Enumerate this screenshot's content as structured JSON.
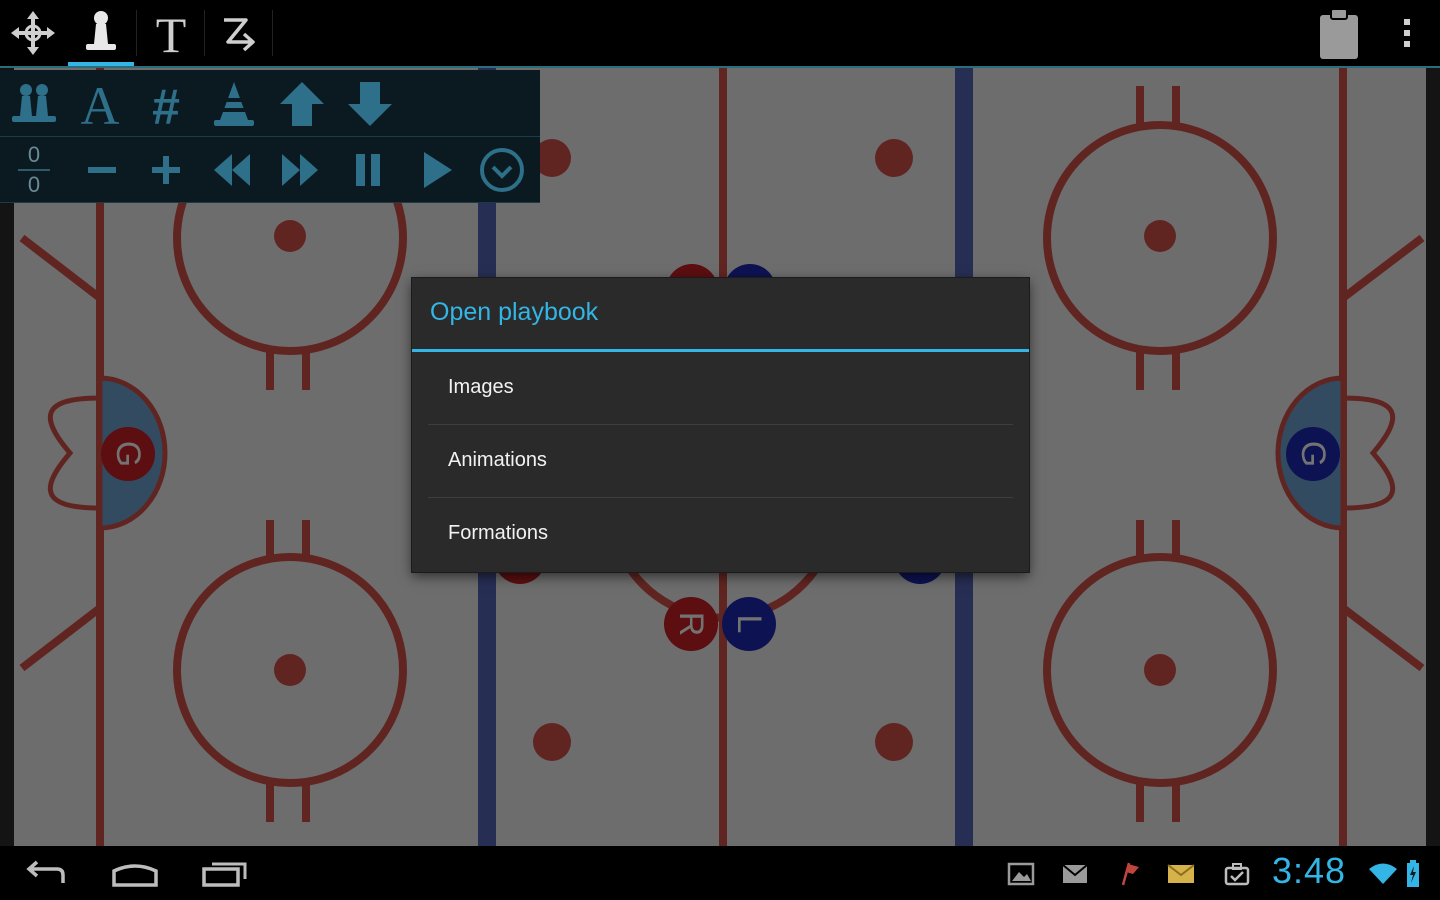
{
  "dialog": {
    "title": "Open playbook",
    "items": [
      {
        "label": "Images"
      },
      {
        "label": "Animations"
      },
      {
        "label": "Formations"
      }
    ]
  },
  "frame_counter": {
    "current": "0",
    "total": "0"
  },
  "players": {
    "goalie_left": "G",
    "goalie_right": "G",
    "right_wing": "R",
    "left_wing": "L"
  },
  "status_bar": {
    "time": "3:48"
  },
  "colors": {
    "accent": "#33b5e5",
    "home_team": "#cc1f25",
    "away_team": "#1e28b8",
    "rink_lines": "#c0463d",
    "blue_line": "#3b4fb0"
  },
  "icons": {
    "actionbar": [
      "move-icon",
      "player-icon",
      "text-icon",
      "draw-line-icon",
      "clipboard-icon",
      "overflow-menu-icon"
    ],
    "tools": [
      "add-player-icon",
      "letter-a-icon",
      "number-icon",
      "cone-icon",
      "arrow-up-icon",
      "arrow-down-icon",
      "minus-icon",
      "plus-icon",
      "rewind-icon",
      "fast-forward-icon",
      "pause-icon",
      "play-icon",
      "timer-icon"
    ],
    "navbar": [
      "back-icon",
      "home-icon",
      "recent-apps-icon"
    ],
    "notifications": [
      "gallery-notification-icon",
      "mail-notification-icon",
      "flag-notification-icon",
      "email-notification-icon",
      "task-notification-icon",
      "wifi-icon",
      "battery-icon"
    ]
  }
}
